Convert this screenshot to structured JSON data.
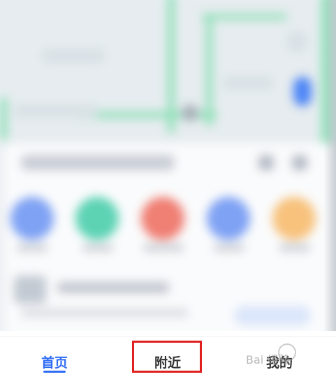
{
  "tab_bar": {
    "home_label": "首页",
    "nearby_label": "附近",
    "mine_label": "我的",
    "active_tab": "首页"
  },
  "colors": {
    "active_tab": "#2f6df6",
    "highlight_box": "#e0201e",
    "inactive_tab": "#333333"
  },
  "watermark": {
    "text": "Bai 经验"
  }
}
